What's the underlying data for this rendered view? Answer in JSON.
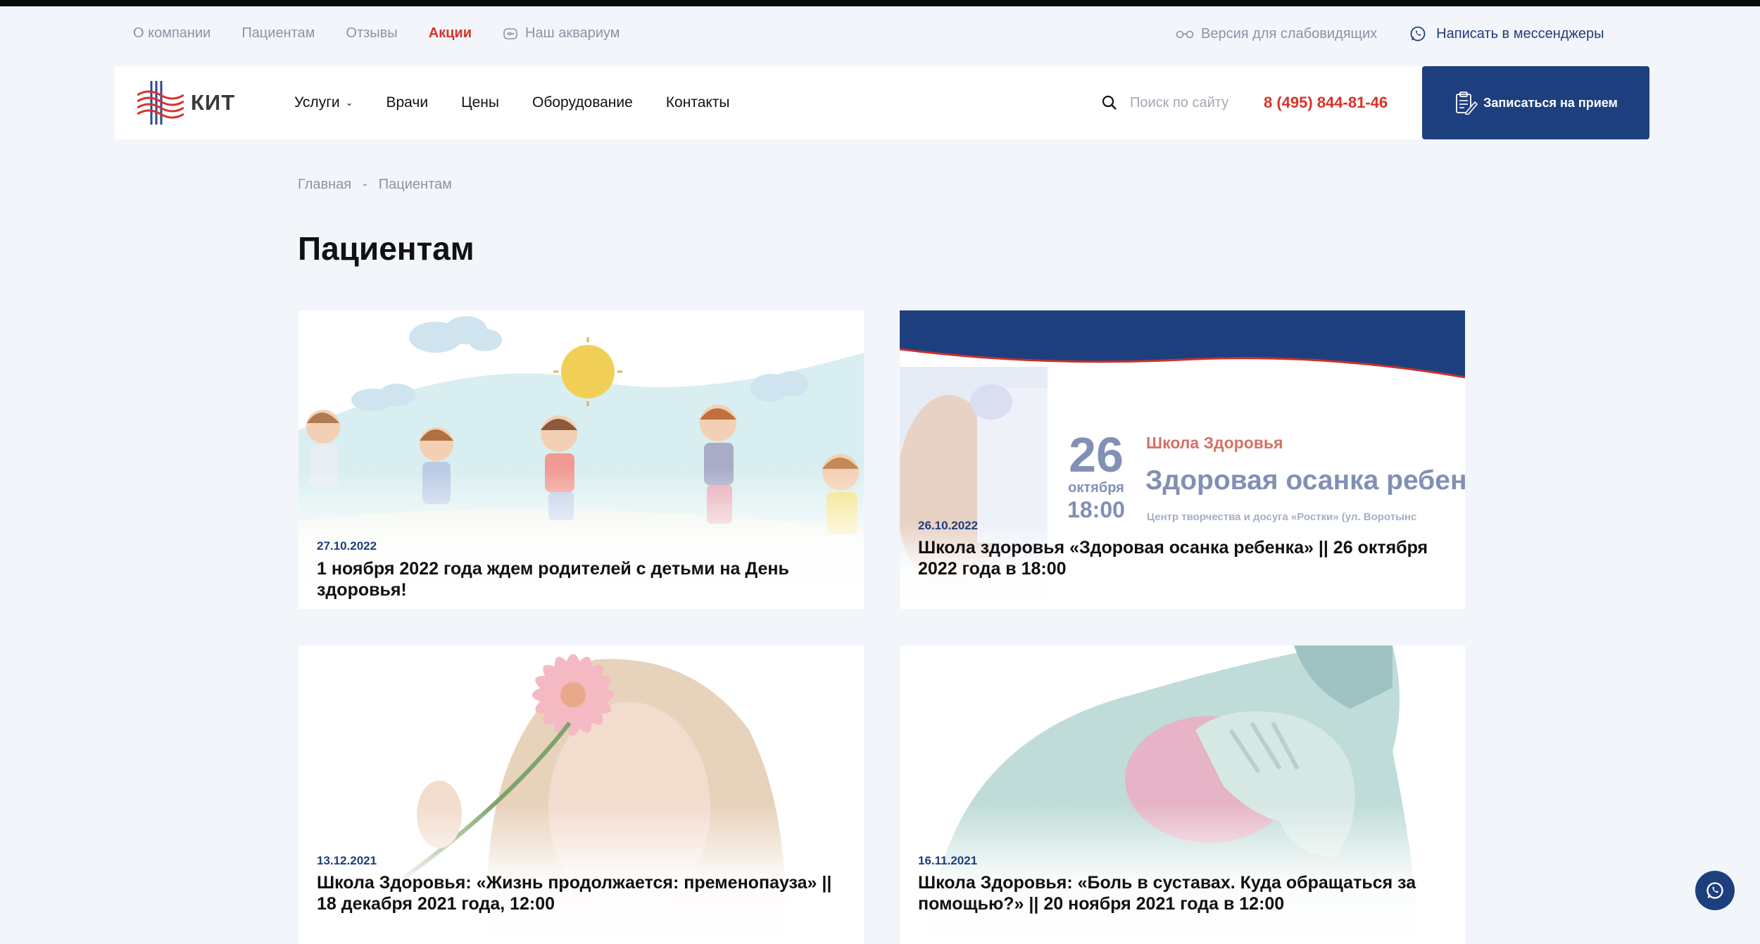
{
  "utility_nav": {
    "about": "О компании",
    "patients": "Пациентам",
    "reviews": "Отзывы",
    "promo": "Акции",
    "aquarium": "Наш аквариум",
    "vision_mode": "Версия для слабовидящих",
    "messenger": "Написать в мессенджеры"
  },
  "header": {
    "logo_text": "КИТ",
    "nav": {
      "services": "Услуги",
      "doctors": "Врачи",
      "prices": "Цены",
      "equipment": "Оборудование",
      "contacts": "Контакты"
    },
    "search_placeholder": "Поиск по сайту",
    "phone": "8 (495) 844-81-46",
    "cta": "Записаться на прием"
  },
  "breadcrumb": {
    "home": "Главная",
    "separator": "-",
    "current": "Пациентам"
  },
  "page_title": "Пациентам",
  "cards": [
    {
      "date": "27.10.2022",
      "title": "1 ноября 2022 года ждем родителей с детьми на День здоровья!"
    },
    {
      "date": "26.10.2022",
      "title": "Школа здоровья «Здоровая осанка ребенка» || 26 октября 2022 года в 18:00",
      "banner": {
        "day": "26",
        "month": "октября",
        "time": "18:00",
        "school": "Школа Здоровья",
        "topic": "Здоровая осанка ребен",
        "venue": "Центр творчества и досуга «Ростки» (ул. Воротынс"
      }
    },
    {
      "date": "13.12.2021",
      "title": "Школа Здоровья: «Жизнь продолжается: пременопауза» || 18 декабря 2021 года, 12:00"
    },
    {
      "date": "16.11.2021",
      "title": "Школа Здоровья: «Боль в суставах. Куда обращаться за помощью?» || 20 ноября 2021 года в 12:00"
    }
  ],
  "colors": {
    "accent_red": "#d7322b",
    "brand_blue": "#1e3f7e",
    "muted_text": "#8c94a3",
    "page_bg": "#f2f5fa"
  }
}
